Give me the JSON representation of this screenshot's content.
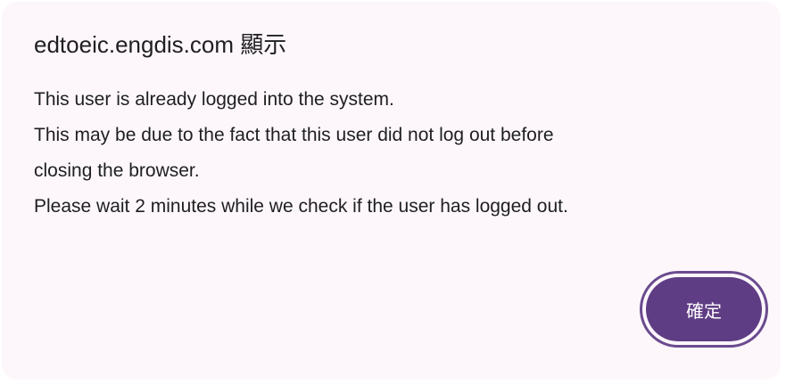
{
  "dialog": {
    "title": "edtoeic.engdis.com 顯示",
    "message_lines": [
      "This user is already logged into the system.",
      "This may be due to the fact that this user did not log out before",
      "closing the browser.",
      "Please wait 2 minutes while we check if the user has logged out."
    ],
    "ok_label": "確定"
  },
  "colors": {
    "dialog_background": "#fdf7fc",
    "button_fill": "#5f3d84",
    "button_ring": "#6b4b8f",
    "text": "#1f1f1f"
  }
}
